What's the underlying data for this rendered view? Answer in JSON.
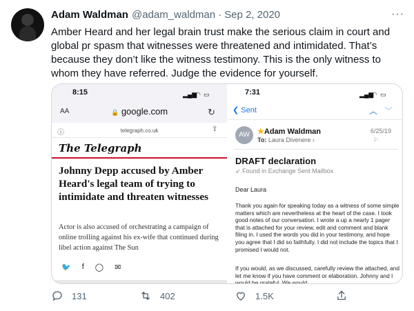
{
  "tweet": {
    "name": "Adam Waldman",
    "handle": "@adam_waldman",
    "separator": "·",
    "date": "Sep 2, 2020",
    "more": "···",
    "text": "Amber Heard and her legal brain trust make the serious claim in court and global pr spasm that witnesses were threatened and intimidated. That’s because they don’t like the witness testimony. This is the only witness to whom they have referred. Judge the evidence for yourself."
  },
  "left_panel": {
    "time": "8:15",
    "aa": "AA",
    "url": "google.com",
    "sub_url": "telegraph.co.uk",
    "brand": "The Telegraph",
    "headline": "Johnny Depp accused by Amber Heard's legal team of trying to intimidate and threaten witnesses",
    "lede": "Actor is also accused of orchestrating a campaign of online trolling against his ex-wife that continued during libel action against The Sun"
  },
  "right_panel": {
    "time": "7:31",
    "back_label": "Sent",
    "avatar_initials": "AW",
    "sender": "Adam Waldman",
    "to_label": "To:",
    "to_name": "Laura Divenere",
    "date": "6/25/19",
    "subject": "DRAFT declaration",
    "found_in": "Found in Exchange Sent Mailbox",
    "greeting": "Dear Laura",
    "body_p1": "Thank you again for speaking today as a witness of some simple matters which are nevertheless at the heart of the case.  I took good notes of our conversation.  I wrote a up a nearly 1 pager that is attached for your review, edit and comment and blank filing in.  I used the words you did in your testimony, and hope you agree that I did so faithfully. I did not include the topics that I promised I would not.",
    "body_p2": "If you would, as we discussed, carefully review the attached, and let me know if you have comment or elaboration. Johnny and I would be grateful. We would"
  },
  "actions": {
    "replies": "131",
    "retweets": "402",
    "likes": "1.5K"
  },
  "colors": {
    "text": "#0f1419",
    "muted": "#536471",
    "ios_blue": "#1a73e8",
    "telegraph_red": "#c8102e"
  }
}
